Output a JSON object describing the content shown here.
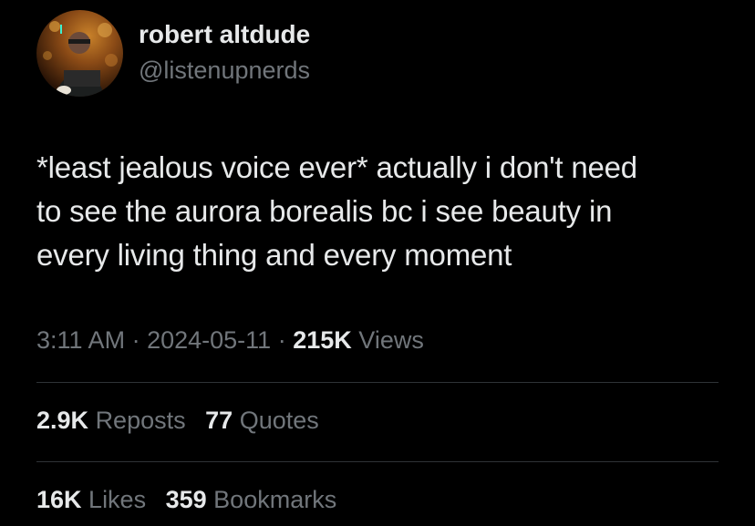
{
  "author": {
    "display_name": "robert altdude",
    "handle": "@listenupnerds",
    "avatar_icon": "profile-photo"
  },
  "tweet": {
    "lines": [
      "*least jealous voice ever* actually i don't need",
      "to see the aurora borealis bc i see beauty in",
      "every living thing and every moment"
    ]
  },
  "meta": {
    "time": "3:11 AM",
    "separator": "·",
    "date": "2024-05-11",
    "views_count": "215K",
    "views_label": "Views"
  },
  "stats": {
    "reposts_count": "2.9K",
    "reposts_label": "Reposts",
    "quotes_count": "77",
    "quotes_label": "Quotes",
    "likes_count": "16K",
    "likes_label": "Likes",
    "bookmarks_count": "359",
    "bookmarks_label": "Bookmarks"
  },
  "colors": {
    "background": "#000000",
    "primary_text": "#e7e9ea",
    "secondary_text": "#71767b",
    "divider": "#2f3336"
  }
}
